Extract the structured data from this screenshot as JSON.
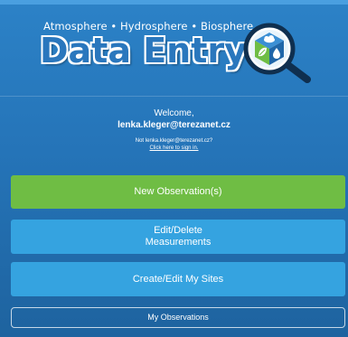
{
  "header": {
    "subtitle": "Atmosphere • Hydrosphere • Biosphere",
    "title": "Data Entry",
    "logo_icon": "magnifier-cube-icon"
  },
  "user": {
    "welcome": "Welcome,",
    "email": "lenka.kleger@terezanet.cz",
    "not_user_text": "Not lenka.kleger@terezanet.cz?",
    "sign_in_link": "Click here to sign in."
  },
  "actions": {
    "new_observation": "New Observation(s)",
    "edit_delete_line1": "Edit/Delete",
    "edit_delete_line2": "Measurements",
    "create_edit_sites": "Create/Edit My Sites",
    "my_observations": "My Observations"
  },
  "colors": {
    "background_top": "#2c82c7",
    "background_bottom": "#1e639f",
    "green_button": "#6fbd44",
    "blue_button": "#35a3e0",
    "title_text": "#2a77bd"
  }
}
